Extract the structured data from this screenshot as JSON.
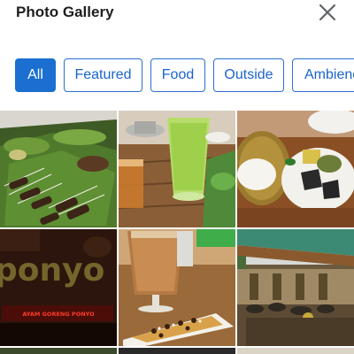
{
  "header": {
    "title": "Photo Gallery"
  },
  "tabs": [
    {
      "label": "All",
      "active": true
    },
    {
      "label": "Featured",
      "active": false
    },
    {
      "label": "Food",
      "active": false
    },
    {
      "label": "Outside",
      "active": false
    },
    {
      "label": "Ambience",
      "active": false
    }
  ],
  "gallery": {
    "photos": [
      {
        "subject": "satay skewers on banana leaves"
      },
      {
        "subject": "green juice and iced tea drinks"
      },
      {
        "subject": "rice plate with fried sides"
      },
      {
        "subject": "neon restaurant sign"
      },
      {
        "subject": "iced coffee with banana dessert"
      },
      {
        "subject": "outdoor dining area"
      }
    ],
    "sign_text": "ponyo",
    "sign_subtext": "AYAM GORENG PONYO"
  },
  "colors": {
    "accent": "#1a6fd0",
    "title_text": "#1f1f1f"
  }
}
